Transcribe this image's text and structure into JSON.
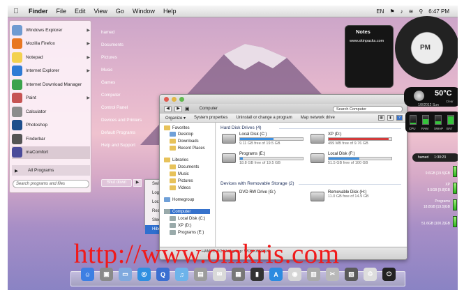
{
  "menubar": {
    "app": "Finder",
    "items": [
      "File",
      "Edit",
      "View",
      "Go",
      "Window",
      "Help"
    ],
    "lang": "EN",
    "time": "6:47 PM"
  },
  "start_menu": {
    "programs": [
      {
        "label": "Windows Explorer",
        "icon": "folder-icon",
        "color": "#6f9bd1",
        "arrow": true
      },
      {
        "label": "Mozilla Firefox",
        "icon": "firefox-icon",
        "color": "#e87722",
        "arrow": true
      },
      {
        "label": "Notepad",
        "icon": "notepad-icon",
        "color": "#f3d14f",
        "arrow": true
      },
      {
        "label": "Internet Explorer",
        "icon": "internet-explorer-icon",
        "color": "#2f7bd5",
        "arrow": true
      },
      {
        "label": "Internet Download Manager",
        "icon": "download-manager-icon",
        "color": "#3ba34c",
        "arrow": false
      },
      {
        "label": "Paint",
        "icon": "paint-icon",
        "color": "#c65353",
        "arrow": true
      },
      {
        "label": "Calculator",
        "icon": "calculator-icon",
        "color": "#8c8c8c",
        "arrow": false
      },
      {
        "label": "Photoshop",
        "icon": "photoshop-icon",
        "color": "#1f4e8c",
        "arrow": false
      },
      {
        "label": "Finderbar",
        "icon": "finderbar-icon",
        "color": "#555555",
        "arrow": false
      },
      {
        "label": "maComfort",
        "icon": "macomfort-icon",
        "color": "#4b4b9a",
        "arrow": false
      }
    ],
    "all_programs": "All Programs",
    "search_placeholder": "Search programs and files",
    "right_items": [
      "hamed",
      "Documents",
      "Pictures",
      "Music",
      "Games",
      "Computer",
      "Control Panel",
      "Devices and Printers",
      "Default Programs",
      "Help and Support"
    ],
    "shutdown": "Shut down",
    "power_menu": [
      "Switch user",
      "Log off",
      "Lock",
      "Restart",
      "Sleep",
      "Hibernate"
    ]
  },
  "explorer": {
    "address": "Computer",
    "search_placeholder": "Search Computer",
    "toolbar": [
      "Organize ▾",
      "System properties",
      "Uninstall or change a program",
      "Map network drive"
    ],
    "nav": {
      "favorites": "Favorites",
      "favorite_items": [
        "Desktop",
        "Downloads",
        "Recent Places"
      ],
      "libraries": "Libraries",
      "library_items": [
        "Documents",
        "Music",
        "Pictures",
        "Videos"
      ],
      "homegroup": "Homegroup",
      "computer": "Computer",
      "computer_items": [
        "Local Disk (C:)",
        "XP (D:)",
        "Programs (E:)"
      ]
    },
    "hard_disk_header": "Hard Disk Drives (4)",
    "drives": [
      {
        "name": "Local Disk (C:)",
        "free": "9.11 GB free of 19.5 GB",
        "used_fraction": 0.53,
        "low": false
      },
      {
        "name": "XP (D:)",
        "free": "499 MB free of 9.76 GB",
        "used_fraction": 0.95,
        "low": true
      },
      {
        "name": "Programs (E:)",
        "free": "18.8 GB free of 19.5 GB",
        "used_fraction": 0.04,
        "low": false
      },
      {
        "name": "Local Disk (F:)",
        "free": "51.5 GB free of 100 GB",
        "used_fraction": 0.49,
        "low": false
      }
    ],
    "removable_header": "Devices with Removable Storage (2)",
    "removable": [
      {
        "name": "DVD RW Drive (G:)",
        "free": ""
      },
      {
        "name": "Removable Disk (H:)",
        "free": "11.0 GB free of 14.9 GB",
        "used_fraction": 0.26
      }
    ],
    "status": "HAMED-PC  Workgroup: WORKGROUP"
  },
  "widgets": {
    "notes_title": "Notes",
    "notes_text": "www.skinpacks.com",
    "clock_ampm": "PM",
    "weather_temp": "50°C",
    "weather_cond": "Clear",
    "weather_date": "1/8/2012 Sun",
    "meters": [
      {
        "label": "CPU",
        "level": 0.2
      },
      {
        "label": "RAM",
        "level": 0.55
      },
      {
        "label": "SWAP",
        "level": 0.3
      },
      {
        "label": "BAT",
        "level": 0.9
      }
    ],
    "calendar": {
      "user": "hamed",
      "time": "1:30:23"
    },
    "drive_meters": [
      {
        "name": "",
        "size": "9.6GB [19.5]GB"
      },
      {
        "name": "XP",
        "size": "9.5GB [9.8]GB"
      },
      {
        "name": "Programs",
        "size": "18.8GB [19.5]GB"
      },
      {
        "name": "",
        "size": "51.6GB [100.2]GB"
      }
    ]
  },
  "watermark": "http://www.omkris.com",
  "dock": {
    "icons": [
      "finder-icon",
      "photo-icon",
      "folder-icon",
      "safari-icon",
      "quicktime-icon",
      "itunes-icon",
      "stack-icon",
      "mail-icon",
      "calculator-icon",
      "terminal-icon",
      "appstore-icon",
      "ipod-icon",
      "disk-icon",
      "utilities-icon",
      "image-icon",
      "trash-icon",
      "power-icon"
    ]
  }
}
